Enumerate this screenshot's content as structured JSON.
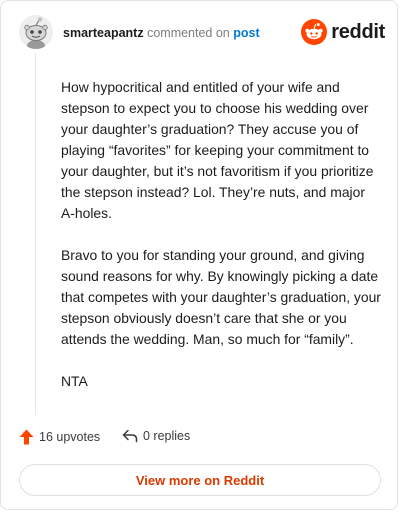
{
  "header": {
    "username": "smarteapantz",
    "action_text": "commented on",
    "post_link": "post",
    "brand": "reddit"
  },
  "comment": {
    "paragraphs": [
      "How hypocritical and entitled of your wife and stepson to expect you to choose his wedding over your daughter’s graduation? They accuse you of playing “favorites” for keeping your commitment to your daughter, but it’s not favoritism if you prioritize the stepson instead? Lol. They’re nuts, and major A-holes.",
      "Bravo to you for standing your ground, and giving sound reasons for why. By knowingly picking a date that competes with your daughter’s graduation, your stepson obviously doesn’t care that she or you attends the wedding. Man, so much for “family”.",
      "NTA"
    ]
  },
  "actions": {
    "upvotes": "16 upvotes",
    "replies": "0 replies"
  },
  "view_button": "View more on Reddit",
  "colors": {
    "brand_orange": "#ff4500",
    "link_blue": "#0079d3",
    "button_text": "#d93a00"
  },
  "icons": {
    "avatar": "snoo-avatar",
    "brand": "reddit-logo-icon",
    "upvote": "upvote-arrow-icon",
    "reply": "reply-arrow-icon"
  }
}
